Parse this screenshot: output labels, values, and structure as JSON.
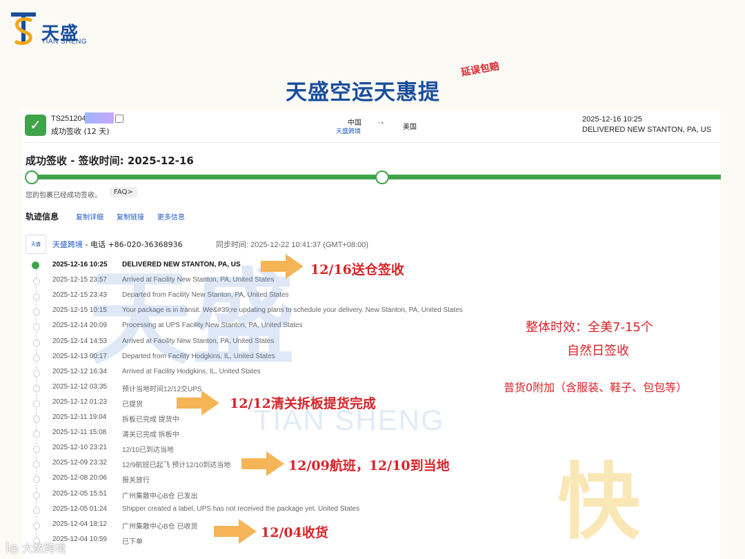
{
  "brand": {
    "name_cn": "天盛",
    "name_en": "TIAN SHENG"
  },
  "headline": "天盛空运天惠提",
  "stamp": "延误包赔",
  "shipment": {
    "tracking_prefix": "TS251204",
    "status_days": "成功签收 (12 天)",
    "origin": "中国",
    "carrier": "天盛跨境",
    "destination": "美国",
    "latest_time": "2025-12-16 10:25",
    "latest_status": "DELIVERED NEW STANTON, PA, US"
  },
  "sign": {
    "title": "成功签收 - 签收时间: 2025-12-16",
    "note": "您的包裹已经成功签收。",
    "faq": "FAQ>"
  },
  "track": {
    "title": "轨迹信息",
    "links": [
      "复制详细",
      "复制链接",
      "更多信息"
    ]
  },
  "carrier_row": {
    "logo_text": "天盛",
    "name": "天盛跨境",
    "phone_label": " - 电话 +86-020-36368936",
    "sync": "同步时间: 2025-12-22 10:41:37 (GMT+08:00)"
  },
  "events": [
    {
      "time": "2025-12-16 10:25",
      "desc": "DELIVERED NEW STANTON, PA, US"
    },
    {
      "time": "2025-12-15 23:57",
      "desc": "Arrived at Facility New Stanton, PA, United States"
    },
    {
      "time": "2025-12-15 23:43",
      "desc": "Departed from Facility New Stanton, PA, United States"
    },
    {
      "time": "2025-12-15 10:15",
      "desc": "Your package is in transit. We&#39;re updating plans to schedule your delivery. New Stanton, PA, United States"
    },
    {
      "time": "2025-12-14 20:09",
      "desc": "Processing at UPS Facility New Stanton, PA, United States"
    },
    {
      "time": "2025-12-14 14:53",
      "desc": "Arrived at Facility New Stanton, PA, United States"
    },
    {
      "time": "2025-12-13 00:17",
      "desc": "Departed from Facility Hodgkins, IL, United States"
    },
    {
      "time": "2025-12-12 16:34",
      "desc": "Arrived at Facility Hodgkins, IL, United States"
    },
    {
      "time": "2025-12-12 03:35",
      "desc": "预计当地时间12/12交UPS"
    },
    {
      "time": "2025-12-12 01:23",
      "desc": "已提货"
    },
    {
      "time": "2025-12-11 19:04",
      "desc": "拆板已完成 提货中"
    },
    {
      "time": "2025-12-11 15:08",
      "desc": "清关已完成 拆板中"
    },
    {
      "time": "2025-12-10 23:21",
      "desc": "12/10已到达当地"
    },
    {
      "time": "2025-12-09 23:32",
      "desc": "12/9航班已起飞 预计12/10到达当地"
    },
    {
      "time": "2025-12-08 20:06",
      "desc": "报关放行"
    },
    {
      "time": "2025-12-05 15:51",
      "desc": "广州集散中心B仓 已发出"
    },
    {
      "time": "2025-12-05 01:24",
      "desc": "Shipper created a label, UPS has not received the package yet. United States"
    },
    {
      "time": "2025-12-04 18:12",
      "desc": "广州集散中心B仓 已收货"
    },
    {
      "time": "2025-12-04 10:59",
      "desc": "已下单"
    }
  ],
  "callouts": [
    "12/16送仓签收",
    "12/12清关拆板提货完成",
    "12/09航班，12/10到当地",
    "12/04收货"
  ],
  "side_notes": [
    "整体时效：全美7-15个",
    "自然日签收",
    "普货0附加（含服装、鞋子、包包等）"
  ],
  "watermark": {
    "cn": "天盛",
    "en": "TIAN SHENG",
    "fast": "快"
  },
  "bottom_brand": "大数跨境",
  "colors": {
    "brand_blue": "#1a4e9c",
    "accent_red": "#d8242a",
    "success_green": "#3fa34a",
    "arrow_orange": "#f5b556"
  }
}
